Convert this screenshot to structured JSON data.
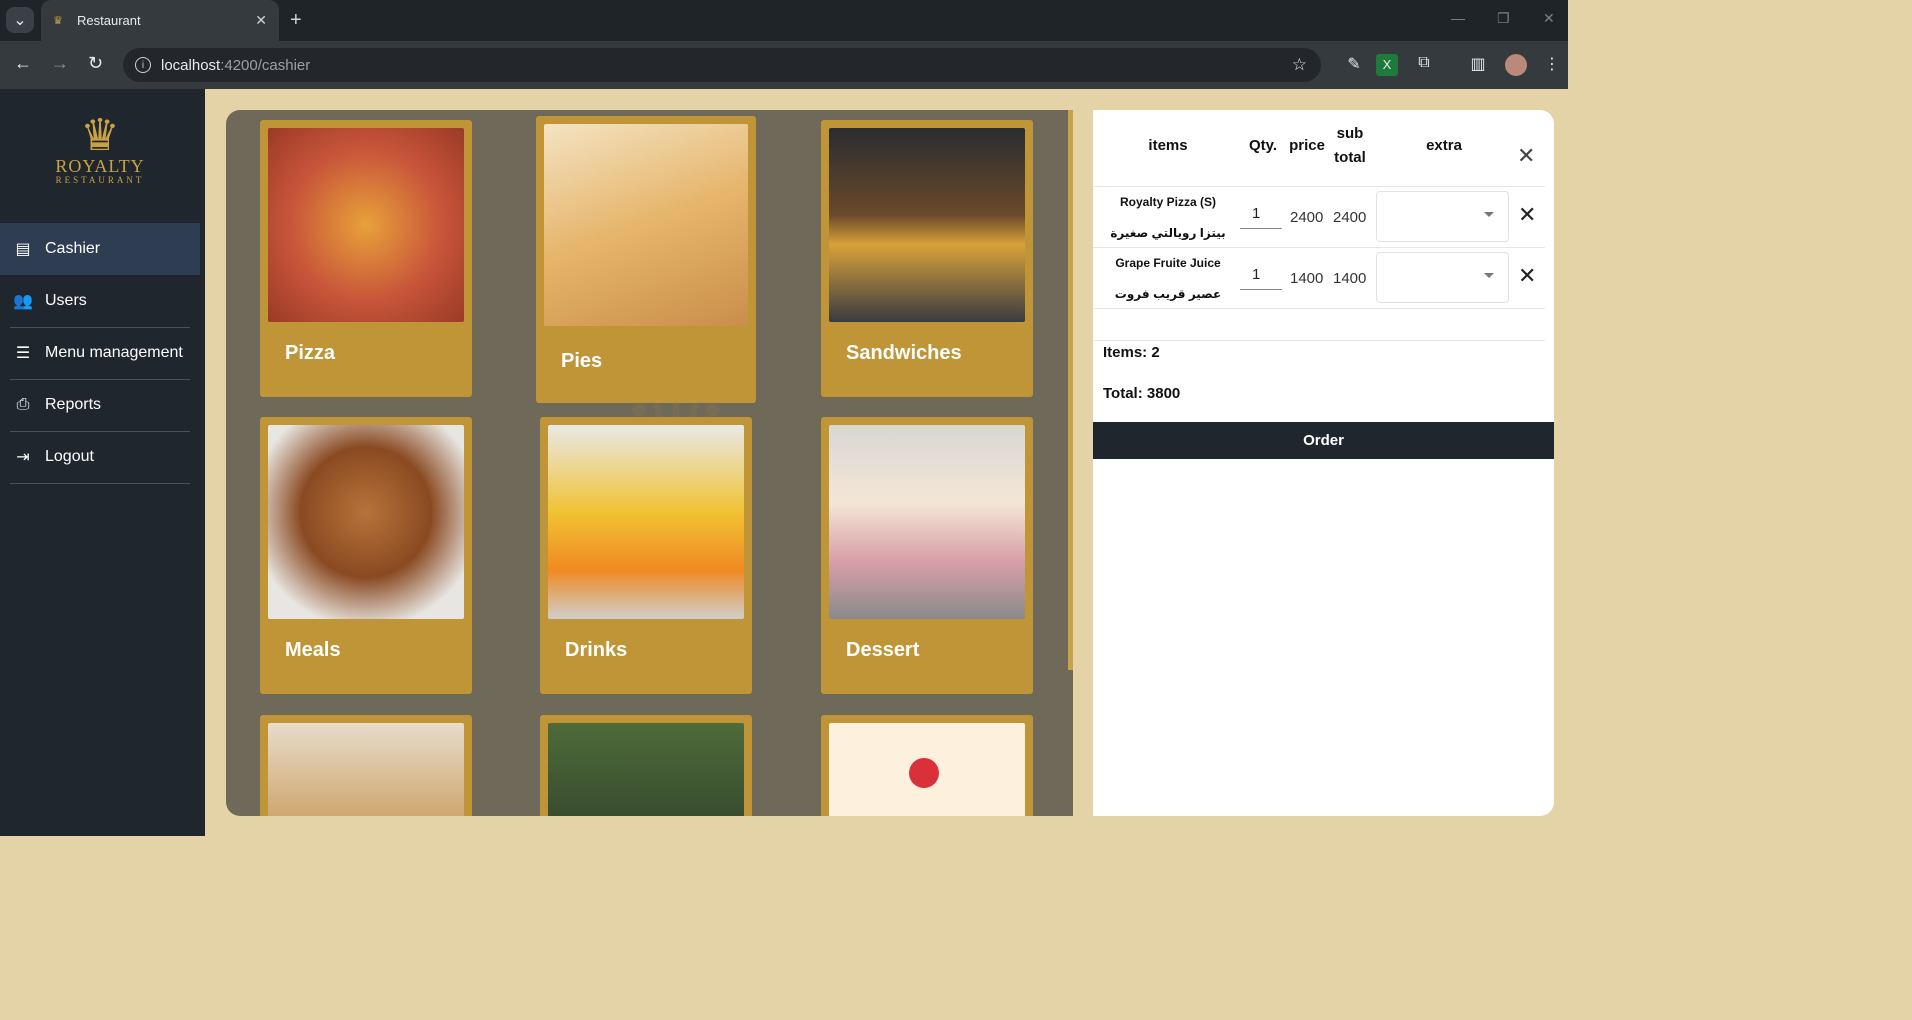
{
  "browser": {
    "tab_title": "Restaurant",
    "url_host": "localhost",
    "url_path": ":4200/cashier"
  },
  "sidebar": {
    "logo": {
      "name": "ROYALTY",
      "subtitle": "RESTAURANT"
    },
    "items": [
      {
        "label": "Cashier",
        "icon": "cash-register-icon",
        "active": true
      },
      {
        "label": "Users",
        "icon": "users-icon"
      },
      {
        "label": "Menu management",
        "icon": "burger-icon"
      },
      {
        "label": "Reports",
        "icon": "printer-icon"
      },
      {
        "label": "Logout",
        "icon": "logout-icon"
      }
    ]
  },
  "menu": {
    "categories": [
      {
        "label": "Pizza",
        "color": "#c8553a"
      },
      {
        "label": "Pies",
        "color": "#e6b46a"
      },
      {
        "label": "Sandwiches",
        "color": "#3a3b3f"
      },
      {
        "label": "Meals",
        "color": "#a9683a"
      },
      {
        "label": "Drinks",
        "color": "#f1c233"
      },
      {
        "label": "Dessert",
        "color": "#d9c9bd"
      },
      {
        "label": "",
        "color": "#c89a5b"
      },
      {
        "label": "",
        "color": "#4e6b3a"
      },
      {
        "label": "",
        "color": "#fdf0dc"
      }
    ]
  },
  "order": {
    "headers": {
      "items": "items",
      "qty": "Qty.",
      "price": "price",
      "subtotal_1": "sub",
      "subtotal_2": "total",
      "extra": "extra"
    },
    "rows": [
      {
        "name_en": "Royalty Pizza (S)",
        "name_ar": "بيتزا رويالتي صغيرة",
        "qty": "1",
        "price": "2400",
        "subtotal": "2400"
      },
      {
        "name_en": "Grape Fruite Juice",
        "name_ar": "عصير قريب فروت",
        "qty": "1",
        "price": "1400",
        "subtotal": "1400"
      }
    ],
    "items_count": "Items: 2",
    "total": "Total: 3800",
    "order_label": "Order"
  }
}
